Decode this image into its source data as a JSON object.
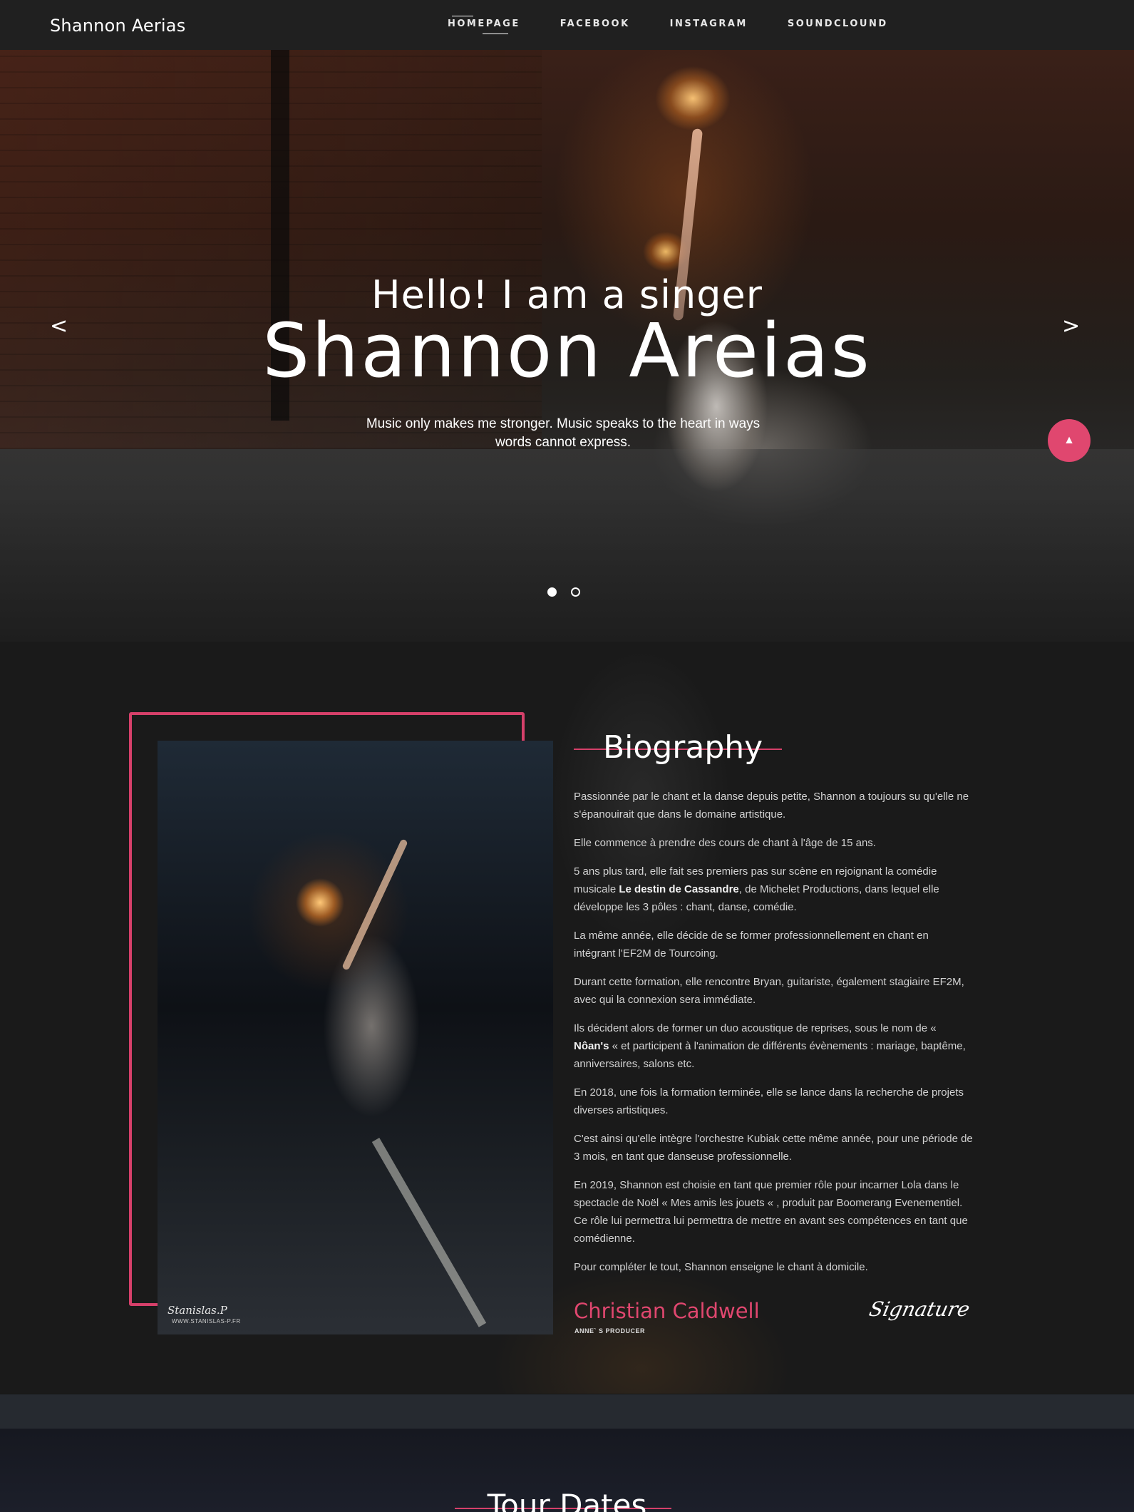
{
  "nav": {
    "brand": "Shannon Aerias",
    "items": [
      {
        "label": "HOMEPAGE",
        "active": true
      },
      {
        "label": "FACEBOOK",
        "active": false
      },
      {
        "label": "INSTAGRAM",
        "active": false
      },
      {
        "label": "SOUNDCLOUND",
        "active": false
      }
    ]
  },
  "hero": {
    "subtitle": "Hello! I am a singer",
    "title": "Shannon Areias",
    "description": "Music only makes me stronger. Music speaks to the heart in ways words cannot express.",
    "prev_label": "<",
    "next_label": ">",
    "slides": 2,
    "active_slide": 1
  },
  "scroll_top": {
    "label": "▲"
  },
  "bio": {
    "title": "Biography",
    "watermark": "Stanislas.P",
    "watermark_url": "WWW.STANISLAS-P.FR",
    "paragraphs": [
      {
        "text": "Passionnée par le chant et la danse depuis petite, Shannon a toujours su qu'elle ne s'épanouirait que dans le domaine artistique."
      },
      {
        "text": "Elle commence à prendre des cours de chant à l'âge de 15 ans."
      },
      {
        "pre": "5 ans plus tard, elle fait ses premiers pas sur scène en rejoignant la comédie musicale ",
        "bold": "Le destin de Cassandre",
        "post": ", de Michelet Productions, dans lequel elle développe les 3 pôles : chant, danse, comédie."
      },
      {
        "text": "La même année, elle décide de se former professionnellement en chant en intégrant l'EF2M de Tourcoing."
      },
      {
        "text": "Durant cette formation, elle rencontre Bryan, guitariste, également stagiaire EF2M, avec qui la connexion sera immédiate."
      },
      {
        "pre": "Ils décident alors de former un duo acoustique de reprises, sous le nom de « ",
        "bold": "Nôan's",
        "post": " « et participent à l'animation de différents évènements : mariage, baptême, anniversaires, salons etc."
      },
      {
        "text": "En 2018, une fois la formation terminée, elle se lance dans la recherche de projets diverses artistiques."
      },
      {
        "text": "C'est ainsi qu'elle intègre l'orchestre Kubiak cette même année, pour une période de 3 mois, en tant que danseuse professionnelle."
      },
      {
        "text": "En 2019, Shannon est choisie en tant que premier rôle pour incarner Lola dans le spectacle de Noël « Mes amis les jouets « , produit par Boomerang Evenementiel. Ce rôle lui permettra lui permettra de mettre en avant ses compétences en tant que comédienne."
      },
      {
        "text": "Pour compléter le tout, Shannon enseigne le chant à domicile."
      }
    ],
    "author": "Christian Caldwell",
    "author_role": "ANNE` S PRODUCER",
    "signature": "Signature"
  },
  "tour": {
    "title": "Tour Dates"
  },
  "colors": {
    "accent": "#e0476f",
    "nav_bg": "#202020",
    "page_bg": "#1a1a1a"
  }
}
